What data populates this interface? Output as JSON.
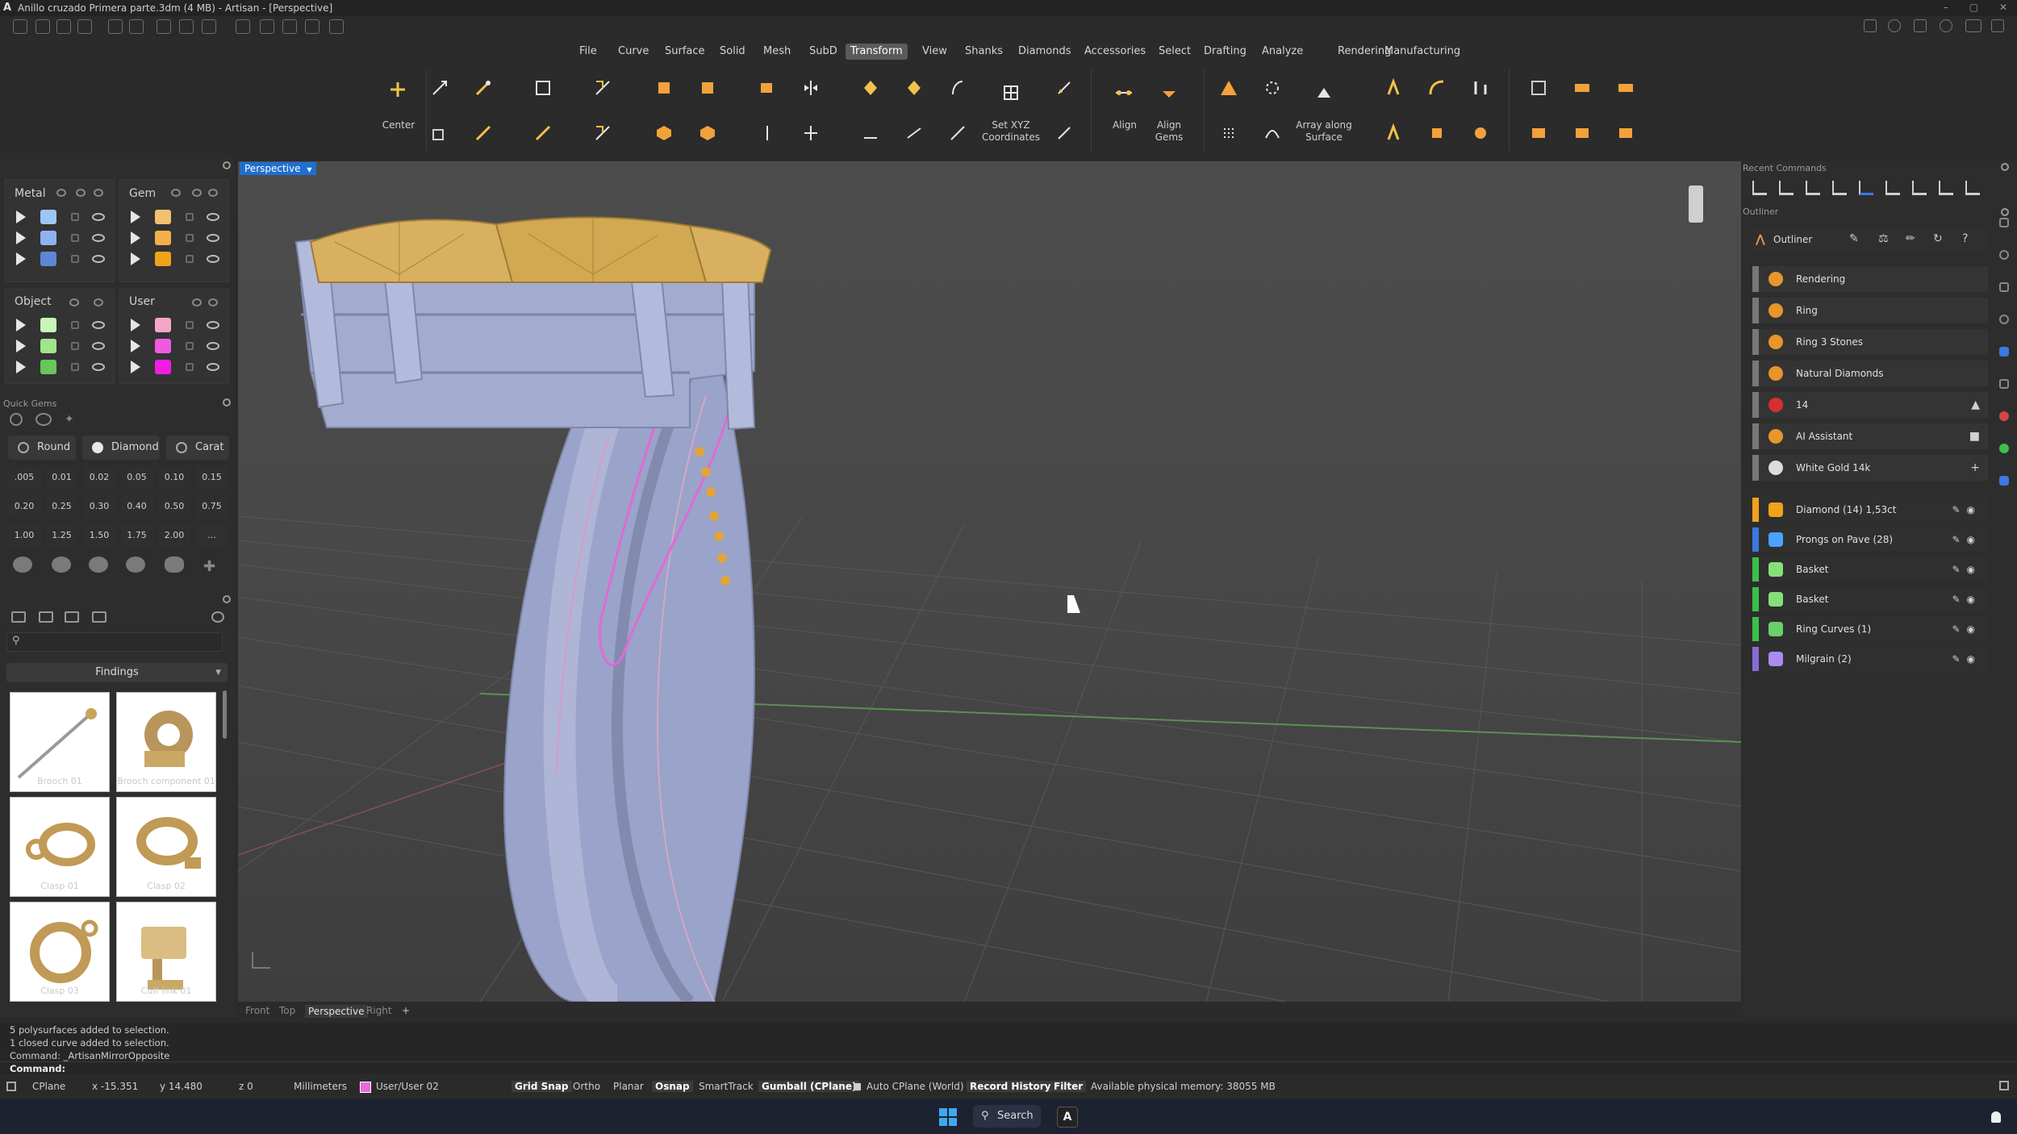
{
  "window": {
    "title": "Anillo cruzado Primera parte.3dm (4 MB) - Artisan - [Perspective]",
    "logo": "A",
    "controls": [
      "–",
      "▢",
      "✕"
    ]
  },
  "menu": {
    "items": [
      "File",
      "Curve",
      "Surface",
      "Solid",
      "Mesh",
      "SubD",
      "Transform",
      "View",
      "Shanks",
      "Diamonds",
      "Accessories",
      "Select",
      "Drafting",
      "Analyze",
      "Rendering",
      "Manufacturing"
    ],
    "active": "Transform"
  },
  "ribbon": {
    "center_label": "Center",
    "setxyz_label_1": "Set XYZ",
    "setxyz_label_2": "Coordinates",
    "align_label": "Align",
    "aligngems_label_1": "Align",
    "aligngems_label_2": "Gems",
    "array_label_1": "Array along",
    "array_label_2": "Surface"
  },
  "layers": {
    "metal_title": "Metal",
    "gem_title": "Gem",
    "object_title": "Object",
    "user_title": "User",
    "metal_colors": [
      "#9ec6f5",
      "#8fb3ef",
      "#5f86d6"
    ],
    "gem_colors": [
      "#f3c070",
      "#f2b04a",
      "#f1a21b"
    ],
    "object_colors": [
      "#c9f5b8",
      "#9fe58a",
      "#67c65c"
    ],
    "user_colors": [
      "#f4a6c8",
      "#f05ae0",
      "#f01ee0"
    ]
  },
  "quick_gems": {
    "title": "Quick Gems",
    "cut": "Round",
    "material": "Diamond",
    "unit": "Carat",
    "sizes": [
      ".005",
      "0.01",
      "0.02",
      "0.05",
      "0.10",
      "0.15",
      "0.20",
      "0.25",
      "0.30",
      "0.40",
      "0.50",
      "0.75",
      "1.00",
      "1.25",
      "1.50",
      "1.75",
      "2.00",
      "..."
    ]
  },
  "library": {
    "category": "Findings",
    "search_placeholder": "",
    "items": [
      "Brooch 01",
      "Brooch component 01",
      "Clasp 01",
      "Clasp 02",
      "Clasp 03",
      "Cuff link 01"
    ]
  },
  "viewport": {
    "title": "Perspective",
    "tabs": [
      "Front",
      "Top",
      "Perspective",
      "Right"
    ],
    "active_tab": "Perspective",
    "add_tab": "+"
  },
  "right_panel": {
    "recent_title": "Recent Commands",
    "outliner_title": "Outliner",
    "outliner_label": "Outliner",
    "materials": [
      {
        "label": "Rendering",
        "color": "#e8962a",
        "tail": ""
      },
      {
        "label": "Ring",
        "color": "#e8962a",
        "tail": ""
      },
      {
        "label": "Ring 3 Stones",
        "color": "#e8962a",
        "tail": ""
      },
      {
        "label": "Natural Diamonds",
        "color": "#e8962a",
        "tail": ""
      },
      {
        "label": "14",
        "color": "#d62f2f",
        "tail": "▲"
      },
      {
        "label": "AI Assistant",
        "color": "#e8962a",
        "tail": "■"
      },
      {
        "label": "White Gold 14k",
        "color": "#dcdcdc",
        "tail": "+"
      }
    ],
    "objects": [
      {
        "label": "Diamond (14) 1,53ct",
        "color": "#f1a21b",
        "bar": "#f1a21b"
      },
      {
        "label": "Prongs on Pave (28)",
        "color": "#4aa3ff",
        "bar": "#3b78e0"
      },
      {
        "label": "Basket",
        "color": "#86e07a",
        "bar": "#3bbf4a"
      },
      {
        "label": "Basket",
        "color": "#86e07a",
        "bar": "#3bbf4a"
      },
      {
        "label": "Ring Curves (1)",
        "color": "#6ad06a",
        "bar": "#3bbf4a"
      },
      {
        "label": "Milgrain (2)",
        "color": "#a98bf2",
        "bar": "#8a6ad8"
      }
    ]
  },
  "command": {
    "history": [
      "5 polysurfaces added to selection.",
      "1 closed curve added to selection.",
      "Command: _ArtisanMirrorOpposite"
    ],
    "prompt": "Command:"
  },
  "status": {
    "cplane": "CPlane",
    "x": "x -15.351",
    "y": "y 14.480",
    "z": "z 0",
    "units": "Millimeters",
    "layer": "User/User 02",
    "grid_snap": "Grid Snap",
    "ortho": "Ortho",
    "planar": "Planar",
    "osnap": "Osnap",
    "smarttrack": "SmartTrack",
    "gumball": "Gumball (CPlane)",
    "auto_cplane": "Auto CPlane (World)",
    "record_history": "Record History",
    "filter": "Filter",
    "memory": "Available physical memory: 38055 MB"
  },
  "taskbar": {
    "search": "Search"
  }
}
